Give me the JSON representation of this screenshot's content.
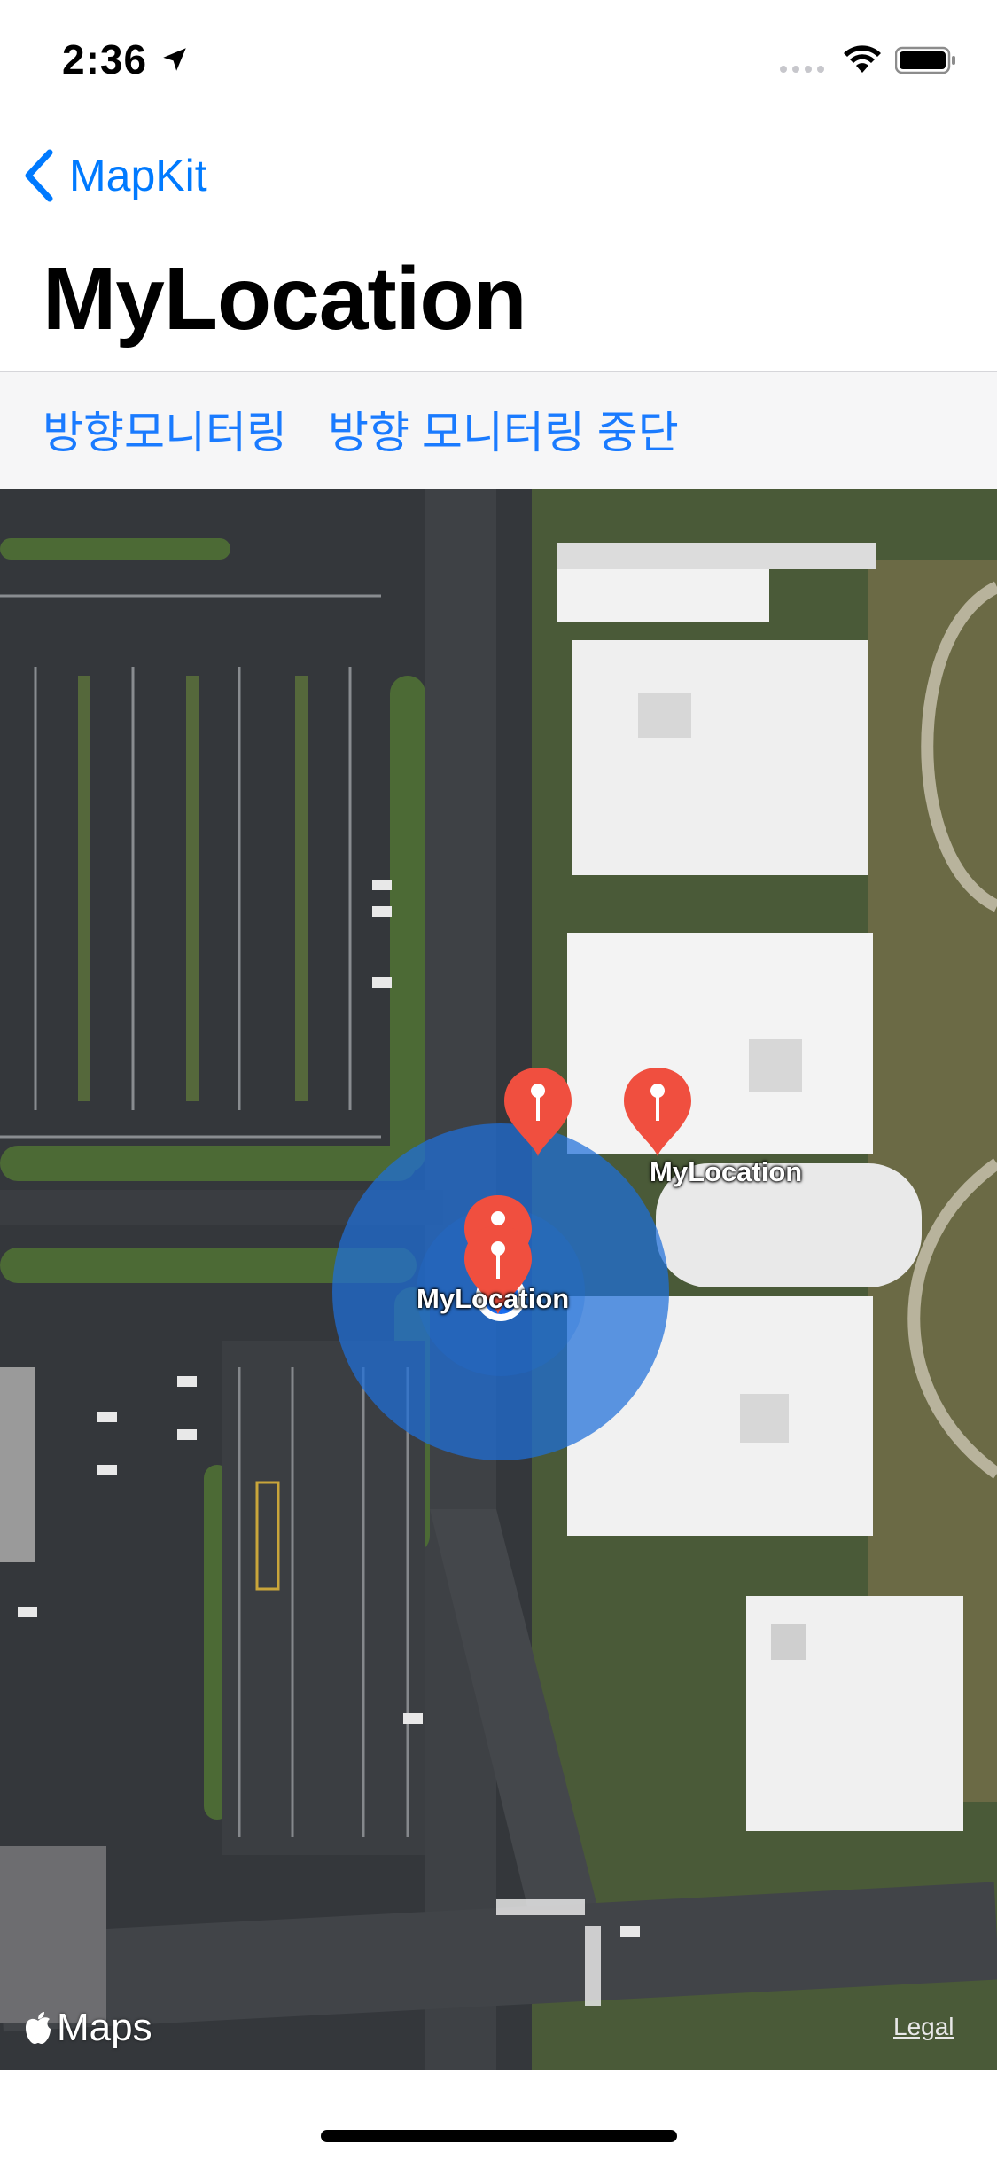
{
  "status_bar": {
    "time": "2:36"
  },
  "nav": {
    "back_label": "MapKit",
    "title": "MyLocation"
  },
  "toolbar": {
    "start_heading_label": "방향모니터링",
    "stop_heading_label": "방향 모니터링 중단"
  },
  "map": {
    "pins": [
      {
        "label": "MyLocation"
      },
      {
        "label": "MyLocation"
      }
    ],
    "maps_attribution": "Maps",
    "legal_label": "Legal",
    "colors": {
      "pin": "#f04f3f",
      "accuracy_circle": "#1e6fd9",
      "user_dot": "#1b6ff0"
    }
  }
}
